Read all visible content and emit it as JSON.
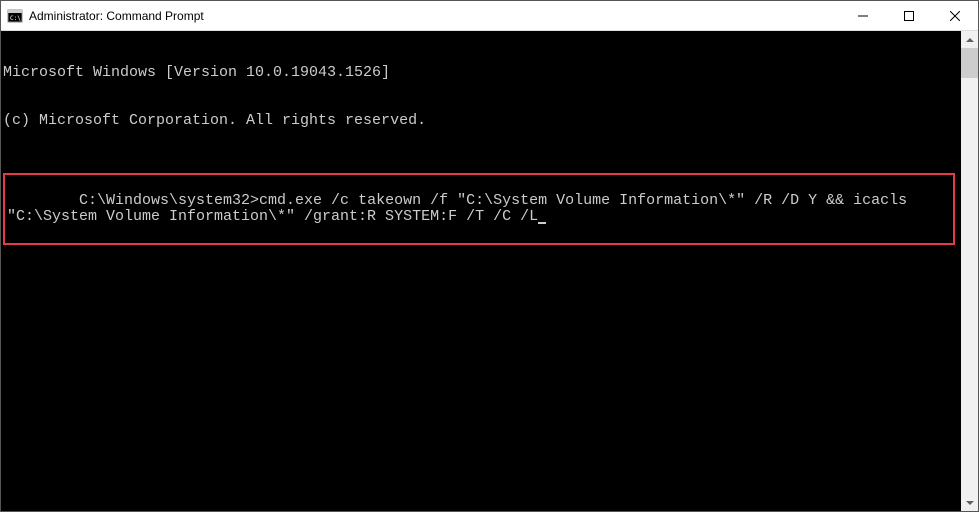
{
  "titlebar": {
    "title": "Administrator: Command Prompt"
  },
  "terminal": {
    "header_line1": "Microsoft Windows [Version 10.0.19043.1526]",
    "header_line2": "(c) Microsoft Corporation. All rights reserved.",
    "prompt": "C:\\Windows\\system32>",
    "command": "cmd.exe /c takeown /f \"C:\\System Volume Information\\*\" /R /D Y && icacls \"C:\\System Volume Information\\*\" /grant:R SYSTEM:F /T /C /L"
  }
}
